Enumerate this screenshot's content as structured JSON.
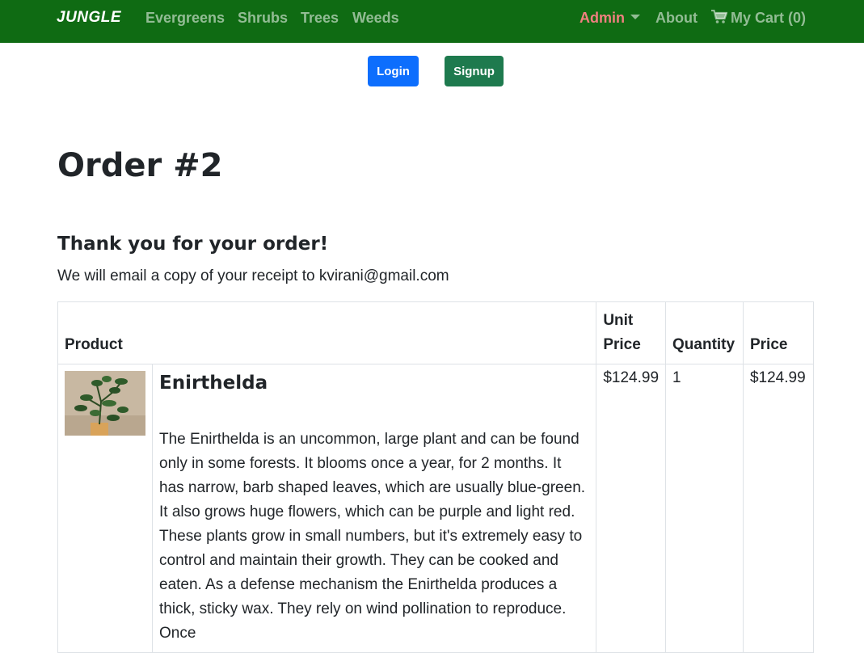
{
  "nav": {
    "brand": "JUNGLE",
    "links": [
      "Evergreens",
      "Shrubs",
      "Trees",
      "Weeds"
    ],
    "admin": "Admin",
    "about": "About",
    "cart": "My Cart (0)"
  },
  "auth": {
    "login": "Login",
    "signup": "Signup"
  },
  "order": {
    "title": "Order #2",
    "thanks": "Thank you for your order!",
    "email_note": "We will email a copy of your receipt to kvirani@gmail.com"
  },
  "table": {
    "headers": {
      "product": "Product",
      "unit_price": "Unit Price",
      "quantity": "Quantity",
      "price": "Price"
    },
    "rows": [
      {
        "name": "Enirthelda",
        "description": "The Enirthelda is an uncommon, large plant and can be found only in some forests. It blooms once a year, for 2 months. It has narrow, barb shaped leaves, which are usually blue-green. It also grows huge flowers, which can be purple and light red. These plants grow in small numbers, but it's extremely easy to control and maintain their growth. They can be cooked and eaten. As a defense mechanism the Enirthelda produces a thick, sticky wax. They rely on wind pollination to reproduce. Once",
        "unit_price": "$124.99",
        "quantity": "1",
        "price": "$124.99"
      }
    ]
  },
  "colors": {
    "navbar": "#0f6b13",
    "login": "#0d6efd",
    "signup": "#1e7a4e",
    "admin": "#f08080"
  }
}
